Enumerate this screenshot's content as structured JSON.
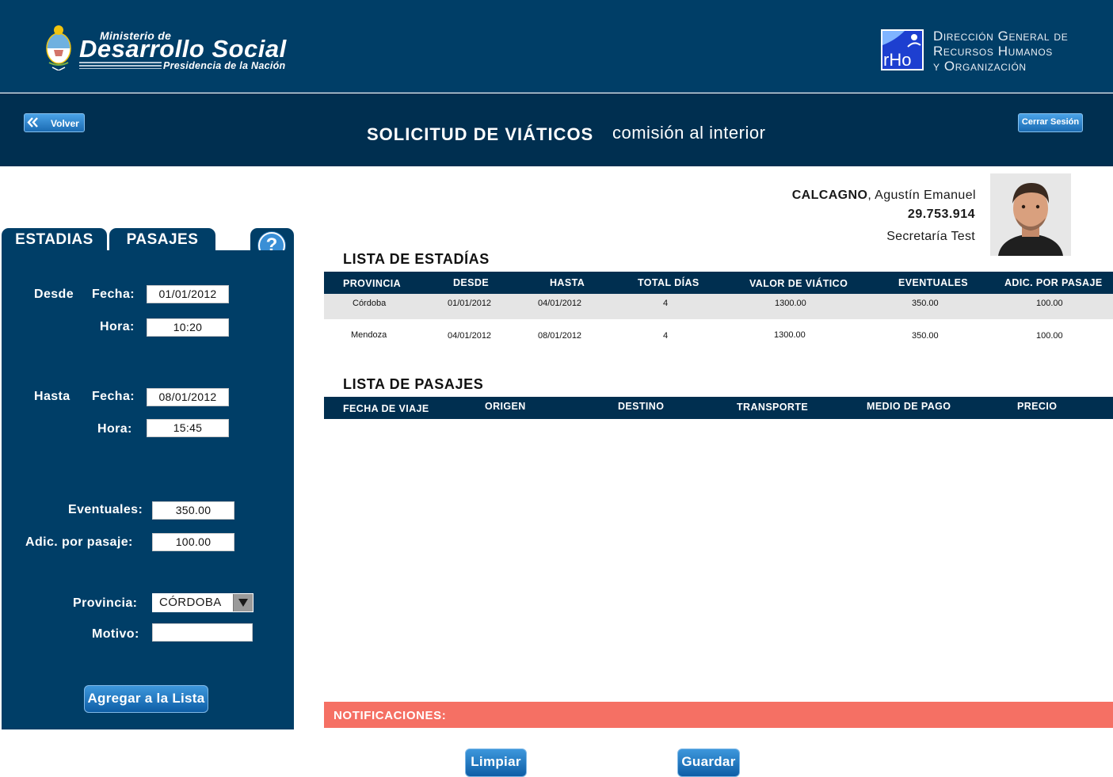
{
  "header": {
    "ministry": {
      "line1": "Ministerio de",
      "line2": "Desarrollo Social",
      "line3": "Presidencia de la Nación"
    },
    "rho_logo": "rHo",
    "direccion": [
      "Dirección General de",
      "Recursos Humanos",
      "y Organización"
    ]
  },
  "title_bar": {
    "back_label": "Volver",
    "title": "SOLICITUD DE VIÁTICOS",
    "subtitle": "comisión al interior",
    "logout_label": "Cerrar Sesión"
  },
  "user": {
    "surname": "CALCAGNO",
    "given": ", Agustín Emanuel",
    "dni": "29.753.914",
    "office": "Secretaría Test"
  },
  "left_panel": {
    "tabs": [
      "ESTADIAS",
      "PASAJES"
    ],
    "help_symbol": "?",
    "desde_label": "Desde",
    "hasta_label": "Hasta",
    "fecha_label": "Fecha:",
    "hora_label": "Hora:",
    "desde_fecha": "01/01/2012",
    "desde_hora": "10:20",
    "hasta_fecha": "08/01/2012",
    "hasta_hora": "15:45",
    "eventuales_label": "Eventuales:",
    "eventuales_value": "350.00",
    "adic_label": "Adic. por pasaje:",
    "adic_value": "100.00",
    "provincia_label": "Provincia:",
    "provincia_value": "CÓRDOBA",
    "motivo_label": "Motivo:",
    "motivo_value": "",
    "add_button": "Agregar a la Lista"
  },
  "estadias": {
    "title": "LISTA DE ESTADÍAS",
    "columns": [
      "PROVINCIA",
      "DESDE",
      "HASTA",
      "TOTAL DÍAS",
      "VALOR DE VIÁTICO",
      "EVENTUALES",
      "ADIC. POR PASAJE"
    ],
    "rows": [
      [
        "Córdoba",
        "01/01/2012",
        "04/01/2012",
        "4",
        "1300.00",
        "350.00",
        "100.00"
      ],
      [
        "Mendoza",
        "04/01/2012",
        "08/01/2012",
        "4",
        "1300.00",
        "350.00",
        "100.00"
      ]
    ]
  },
  "pasajes": {
    "title": "LISTA DE PASAJES",
    "columns": [
      "FECHA DE VIAJE",
      "ORIGEN",
      "DESTINO",
      "TRANSPORTE",
      "MEDIO DE PAGO",
      "PRECIO"
    ]
  },
  "notifications": {
    "label": "NOTIFICACIONES:"
  },
  "actions": {
    "clear": "Limpiar",
    "save": "Guardar"
  },
  "colors": {
    "navy": "#003e67",
    "dark_navy": "#002f50",
    "notification": "#f57064",
    "button_blue": "#1b6bb2"
  }
}
